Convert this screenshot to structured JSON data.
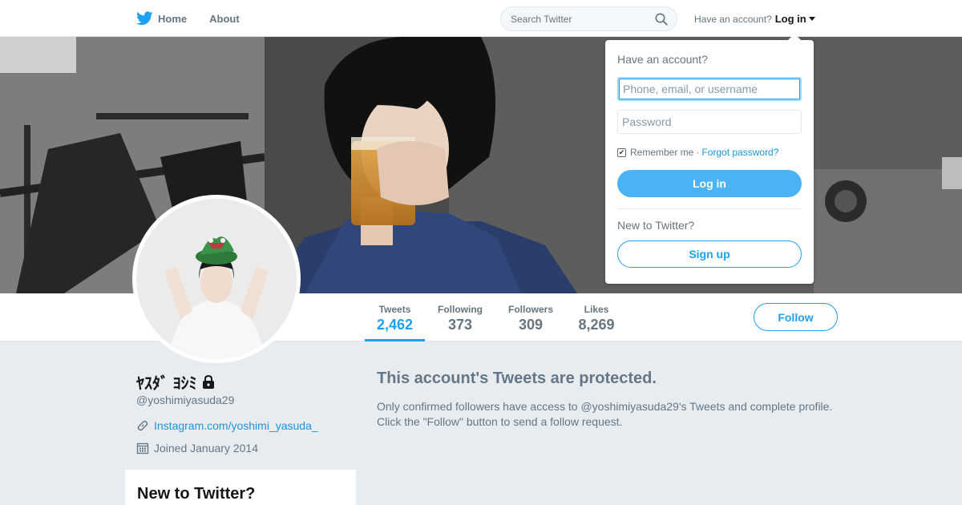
{
  "nav": {
    "home_label": "Home",
    "about_label": "About",
    "search_placeholder": "Search Twitter",
    "have_account_text": "Have an account?",
    "login_label": "Log in"
  },
  "colors": {
    "accent": "#1da1f2",
    "login_button": "#4ab3f4",
    "page_background": "#e6ecf0",
    "muted_text": "#657786"
  },
  "profile_nav": {
    "stats": [
      {
        "label": "Tweets",
        "value": "2,462",
        "active": true
      },
      {
        "label": "Following",
        "value": "373",
        "active": false
      },
      {
        "label": "Followers",
        "value": "309",
        "active": false
      },
      {
        "label": "Likes",
        "value": "8,269",
        "active": false
      }
    ],
    "follow_label": "Follow"
  },
  "profile": {
    "name": "ﾔｽﾀﾞ ﾖｼﾐ",
    "screen_name": "@yoshimiyasuda29",
    "link": "Instagram.com/yoshimi_yasuda_",
    "joined": "Joined January 2014",
    "protected_badge_icon": "lock-icon"
  },
  "sidebar": {
    "new_to_twitter_heading": "New to Twitter?"
  },
  "protected": {
    "title": "This account's Tweets are protected.",
    "line1": "Only confirmed followers have access to @yoshimiyasuda29's Tweets and complete profile.",
    "line2": "Click the \"Follow\" button to send a follow request."
  },
  "login_dropdown": {
    "heading": "Have an account?",
    "username_placeholder": "Phone, email, or username",
    "password_placeholder": "Password",
    "remember_label": "Remember me",
    "separator": "·",
    "forgot_label": "Forgot password?",
    "login_button": "Log in",
    "new_heading": "New to Twitter?",
    "signup_button": "Sign up"
  }
}
